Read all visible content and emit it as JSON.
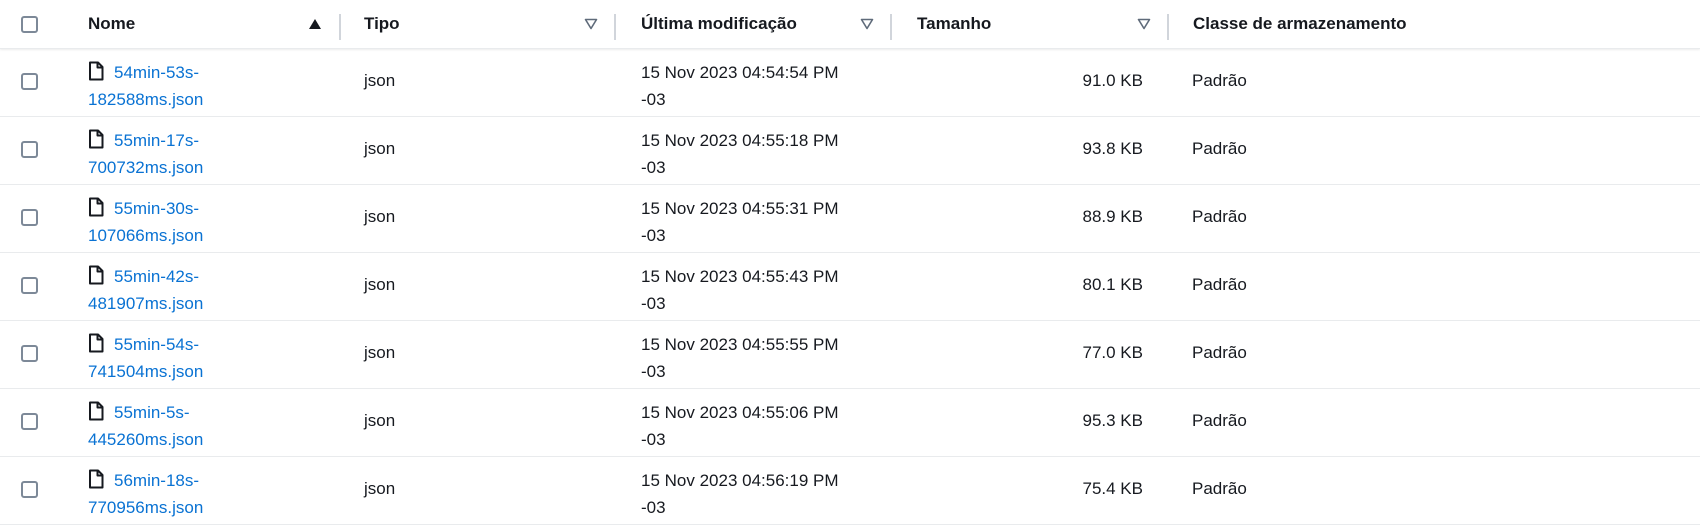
{
  "columns": {
    "name": "Nome",
    "type": "Tipo",
    "modified": "Última modificação",
    "size": "Tamanho",
    "storage_class": "Classe de armazenamento"
  },
  "rows": [
    {
      "name_line1": "54min-53s-",
      "name_line2": "182588ms.json",
      "type": "json",
      "date_line1": "15 Nov 2023 04:54:54 PM",
      "date_line2": "-03",
      "size": "91.0 KB",
      "storage_class": "Padrão"
    },
    {
      "name_line1": "55min-17s-",
      "name_line2": "700732ms.json",
      "type": "json",
      "date_line1": "15 Nov 2023 04:55:18 PM",
      "date_line2": "-03",
      "size": "93.8 KB",
      "storage_class": "Padrão"
    },
    {
      "name_line1": "55min-30s-",
      "name_line2": "107066ms.json",
      "type": "json",
      "date_line1": "15 Nov 2023 04:55:31 PM",
      "date_line2": "-03",
      "size": "88.9 KB",
      "storage_class": "Padrão"
    },
    {
      "name_line1": "55min-42s-",
      "name_line2": "481907ms.json",
      "type": "json",
      "date_line1": "15 Nov 2023 04:55:43 PM",
      "date_line2": "-03",
      "size": "80.1 KB",
      "storage_class": "Padrão"
    },
    {
      "name_line1": "55min-54s-",
      "name_line2": "741504ms.json",
      "type": "json",
      "date_line1": "15 Nov 2023 04:55:55 PM",
      "date_line2": "-03",
      "size": "77.0 KB",
      "storage_class": "Padrão"
    },
    {
      "name_line1": "55min-5s-",
      "name_line2": "445260ms.json",
      "type": "json",
      "date_line1": "15 Nov 2023 04:55:06 PM",
      "date_line2": "-03",
      "size": "95.3 KB",
      "storage_class": "Padrão"
    },
    {
      "name_line1": "56min-18s-",
      "name_line2": "770956ms.json",
      "type": "json",
      "date_line1": "15 Nov 2023 04:56:19 PM",
      "date_line2": "-03",
      "size": "75.4 KB",
      "storage_class": "Padrão"
    }
  ],
  "sort": {
    "column": "name",
    "direction": "ascending"
  },
  "colors": {
    "link": "#0972d3",
    "header_text": "#16191f",
    "divider": "#d1d5db"
  }
}
